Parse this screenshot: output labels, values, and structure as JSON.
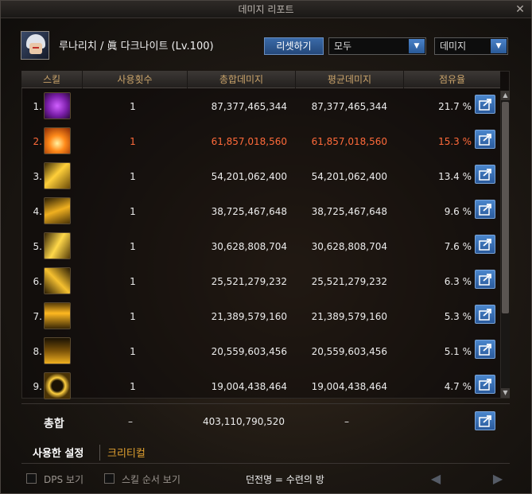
{
  "window": {
    "title": "데미지 리포트",
    "close": "✕"
  },
  "character": {
    "name": "루나리치 / 眞 다크나이트 (Lv.100)"
  },
  "controls": {
    "reset_label": "리셋하기",
    "filter_value": "모두",
    "type_value": "데미지"
  },
  "columns": [
    "스킬",
    "사용횟수",
    "총합데미지",
    "평균데미지",
    "점유율"
  ],
  "rows": [
    {
      "num": "1.",
      "count": "1",
      "total": "87,377,465,344",
      "avg": "87,377,465,344",
      "share": "21.7 %",
      "icon": "purple-slash-skill-icon",
      "highlight": false
    },
    {
      "num": "2.",
      "count": "1",
      "total": "61,857,018,560",
      "avg": "61,857,018,560",
      "share": "15.3 %",
      "icon": "fire-burst-skill-icon",
      "highlight": true
    },
    {
      "num": "3.",
      "count": "1",
      "total": "54,201,062,400",
      "avg": "54,201,062,400",
      "share": "13.4 %",
      "icon": "golden-strike-skill-icon",
      "highlight": false
    },
    {
      "num": "4.",
      "count": "1",
      "total": "38,725,467,648",
      "avg": "38,725,467,648",
      "share": "9.6 %",
      "icon": "golden-wave-skill-icon",
      "highlight": false
    },
    {
      "num": "5.",
      "count": "1",
      "total": "30,628,808,704",
      "avg": "30,628,808,704",
      "share": "7.6 %",
      "icon": "golden-thrust-skill-icon",
      "highlight": false
    },
    {
      "num": "6.",
      "count": "1",
      "total": "25,521,279,232",
      "avg": "25,521,279,232",
      "share": "6.3 %",
      "icon": "cross-blade-skill-icon",
      "highlight": false
    },
    {
      "num": "7.",
      "count": "1",
      "total": "21,389,579,160",
      "avg": "21,389,579,160",
      "share": "5.3 %",
      "icon": "rising-flame-skill-icon",
      "highlight": false
    },
    {
      "num": "8.",
      "count": "1",
      "total": "20,559,603,456",
      "avg": "20,559,603,456",
      "share": "5.1 %",
      "icon": "ground-spike-skill-icon",
      "highlight": false
    },
    {
      "num": "9.",
      "count": "1",
      "total": "19,004,438,464",
      "avg": "19,004,438,464",
      "share": "4.7 %",
      "icon": "golden-ring-skill-icon",
      "highlight": false
    }
  ],
  "summary": {
    "label": "총합",
    "count": "–",
    "total": "403,110,790,520",
    "avg": "–"
  },
  "tabs": [
    {
      "label": "사용한 설정",
      "active": true
    },
    {
      "label": "크리티컬",
      "active": false
    }
  ],
  "footer": {
    "dps_label": "DPS 보기",
    "order_label": "스킬 순서 보기",
    "dungeon": "던전명 = 수련의 방"
  },
  "colors": {
    "header_text": "#c9a36a",
    "highlight": "#ff6a3a",
    "button_blue": "#3a6aa8",
    "tab_inactive": "#e0a030"
  }
}
